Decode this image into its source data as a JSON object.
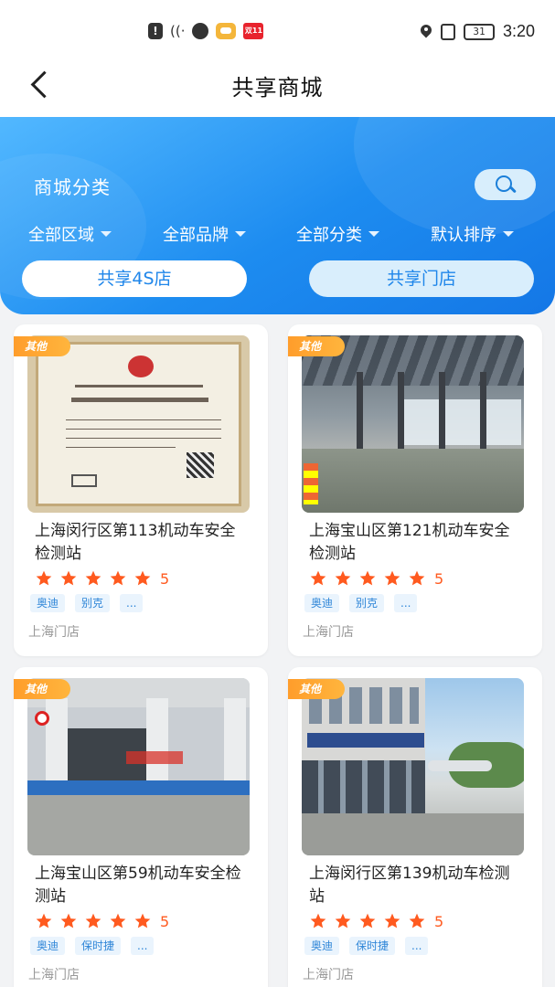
{
  "status_bar": {
    "time": "3:20",
    "battery": "31",
    "shopping_badge": "双11",
    "icons": [
      "alert-icon",
      "wifi-icon",
      "globe-icon",
      "app-icon",
      "shopping-icon",
      "location-icon",
      "vibrate-icon",
      "battery-icon"
    ]
  },
  "header": {
    "title": "共享商城",
    "back_icon": "back-arrow-icon"
  },
  "hero": {
    "section_title": "商城分类",
    "search_icon": "search-icon",
    "filters": [
      {
        "label": "全部区域"
      },
      {
        "label": "全部品牌"
      },
      {
        "label": "全部分类"
      },
      {
        "label": "默认排序"
      }
    ],
    "tabs": [
      {
        "label": "共享4S店",
        "active": true
      },
      {
        "label": "共享门店",
        "active": false
      }
    ],
    "colors": {
      "gradient_start": "#52b8ff",
      "gradient_end": "#1477e6",
      "accent": "#1f86ea"
    }
  },
  "stores": [
    {
      "tag": "其他",
      "name": "上海闵行区第113机动车安全检测站",
      "rating": "5",
      "stars": 5,
      "brands": [
        "奥迪",
        "别克",
        "..."
      ],
      "location": "上海门店",
      "photo_type": "certificate"
    },
    {
      "tag": "其他",
      "name": "上海宝山区第121机动车安全检测站",
      "rating": "5",
      "stars": 5,
      "brands": [
        "奥迪",
        "别克",
        "..."
      ],
      "location": "上海门店",
      "photo_type": "inspection-hall"
    },
    {
      "tag": "其他",
      "name": "上海宝山区第59机动车安全检测站",
      "rating": "5",
      "stars": 5,
      "brands": [
        "奥迪",
        "保时捷",
        "..."
      ],
      "location": "上海门店",
      "photo_type": "inspection-bay"
    },
    {
      "tag": "其他",
      "name": "上海闵行区第139机动车检测站",
      "rating": "5",
      "stars": 5,
      "brands": [
        "奥迪",
        "保时捷",
        "..."
      ],
      "location": "上海门店",
      "photo_type": "street-view"
    }
  ],
  "colors": {
    "star": "#ff5a1f",
    "tag": "#ffa22f",
    "brand_bg": "#eaf4fd",
    "brand_text": "#2f86d8"
  }
}
